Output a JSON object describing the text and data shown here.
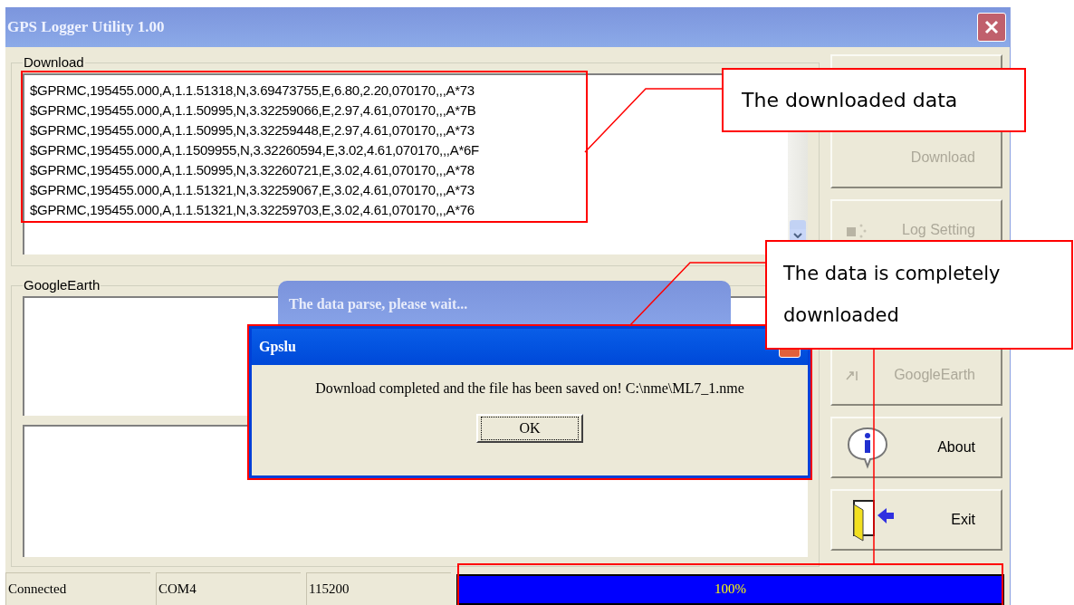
{
  "window": {
    "title": "GPS Logger Utility 1.00"
  },
  "download_group": {
    "label": "Download",
    "lines": [
      "$GPRMC,195455.000,A,1.1.51318,N,3.69473755,E,6.80,2.20,070170,,,A*73",
      "$GPRMC,195455.000,A,1.1.50995,N,3.32259066,E,2.97,4.61,070170,,,A*7B",
      "$GPRMC,195455.000,A,1.1.50995,N,3.32259448,E,2.97,4.61,070170,,,A*73",
      "$GPRMC,195455.000,A,1.1509955,N,3.32260594,E,3.02,4.61,070170,,,A*6F",
      "$GPRMC,195455.000,A,1.1.50995,N,3.32260721,E,3.02,4.61,070170,,,A*78",
      "$GPRMC,195455.000,A,1.1.51321,N,3.32259067,E,3.02,4.61,070170,,,A*73",
      "$GPRMC,195455.000,A,1.1.51321,N,3.32259703,E,3.02,4.61,070170,,,A*76"
    ]
  },
  "googleearth_group": {
    "label": "GoogleEarth"
  },
  "buttons": [
    {
      "kind": "blank"
    },
    {
      "label": "Download",
      "disabled": true
    },
    {
      "label": "Log Setting",
      "disabled": true,
      "kind": "gear"
    },
    {
      "label": "GoogleEarth",
      "disabled": true,
      "kind": "cursor"
    },
    {
      "label": "About",
      "disabled": false,
      "kind": "info"
    },
    {
      "label": "Exit",
      "disabled": false,
      "kind": "door"
    }
  ],
  "status_bar": [
    "Connected",
    "COM4",
    "115200"
  ],
  "progress": {
    "level": 1,
    "reading": "100%"
  },
  "busy_window": {
    "title": "The data parse, please wait..."
  },
  "dialog": {
    "title": "Gpslu",
    "message": "Download completed and the file has been saved on! C:\\nme\\ML7_1.nme",
    "button": "OK"
  },
  "annotations": [
    {
      "text": "The downloaded data"
    },
    {
      "text": "The data is completely downloaded"
    }
  ]
}
